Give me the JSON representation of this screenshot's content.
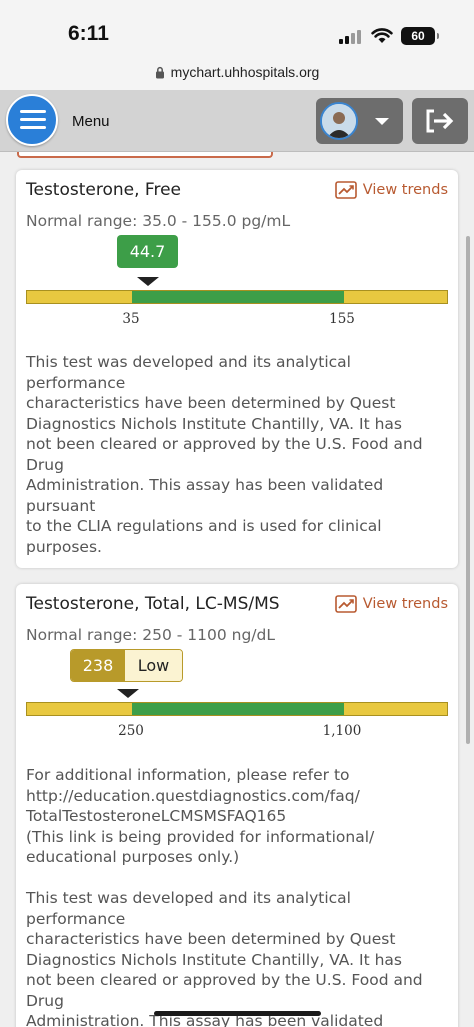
{
  "status_bar": {
    "time": "6:11",
    "battery": "60"
  },
  "browser": {
    "url": "mychart.uhhospitals.org"
  },
  "header": {
    "menu_label": "Menu"
  },
  "results": [
    {
      "title": "Testosterone, Free",
      "trends_label": "View trends",
      "normal_range": "Normal range: 35.0 - 155.0 pg/mL",
      "value": "44.7",
      "flag": "",
      "low_tick": "35",
      "high_tick": "155",
      "value_numeric": 44.7,
      "low": 35,
      "high": 155,
      "note": "This test was developed and its analytical\nperformance\ncharacteristics have been determined by Quest\nDiagnostics Nichols Institute Chantilly, VA. It has\nnot been cleared or approved by the U.S. Food and\nDrug\nAdministration. This assay has been validated\npursuant\nto the CLIA regulations and is used for clinical\npurposes."
    },
    {
      "title": "Testosterone, Total, LC-MS/MS",
      "trends_label": "View trends",
      "normal_range": "Normal range: 250 - 1100 ng/dL",
      "value": "238",
      "flag": "Low",
      "low_tick": "250",
      "high_tick": "1,100",
      "value_numeric": 238,
      "low": 250,
      "high": 1100,
      "note": "For additional information, please refer to\nhttp://education.questdiagnostics.com/faq/\nTotalTestosteroneLCMSMSFAQ165\n(This link is being provided for informational/\neducational purposes only.)\n\nThis test was developed and its analytical\nperformance\ncharacteristics have been determined by Quest\nDiagnostics Nichols Institute Chantilly, VA. It has\nnot been cleared or approved by the U.S. Food and\nDrug\nAdministration. This assay has been validated"
    }
  ],
  "colors": {
    "normal_fill": "#3d9e48",
    "out_of_range": "#e8c840",
    "value_badge_normal": "#3d9e48",
    "value_badge_low": "#b89a2a",
    "trends_link": "#b85a31",
    "menu_button": "#2a7fd8"
  },
  "icons": {
    "menu": "hamburger-icon",
    "profile_caret": "caret-down-icon",
    "logout": "logout-icon",
    "trends": "trend-chart-icon",
    "lock": "lock-icon"
  }
}
